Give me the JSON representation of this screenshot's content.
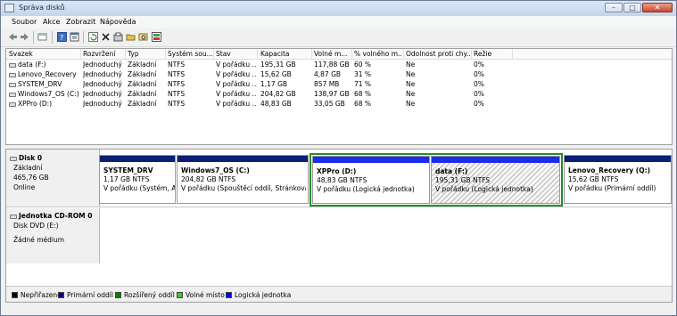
{
  "window": {
    "title": "Správa disků"
  },
  "menu": [
    "Soubor",
    "Akce",
    "Zobrazit",
    "Nápověda"
  ],
  "table": {
    "columns": [
      "Svazek",
      "Rozvržení",
      "Typ",
      "Systém sou...",
      "Stav",
      "Kapacita",
      "Volné m...",
      "% volného m...",
      "Odolnost proti chy...",
      "Režie"
    ],
    "rows": [
      [
        "data (F:)",
        "Jednoduchý",
        "Základní",
        "NTFS",
        "V pořádku ...",
        "195,31 GB",
        "117,88 GB",
        "60 %",
        "Ne",
        "0%"
      ],
      [
        "Lenovo_Recovery ...",
        "Jednoduchý",
        "Základní",
        "NTFS",
        "V pořádku ...",
        "15,62 GB",
        "4,87 GB",
        "31 %",
        "Ne",
        "0%"
      ],
      [
        "SYSTEM_DRV",
        "Jednoduchý",
        "Základní",
        "NTFS",
        "V pořádku ...",
        "1,17 GB",
        "857 MB",
        "71 %",
        "Ne",
        "0%"
      ],
      [
        "Windows7_OS (C:)",
        "Jednoduchý",
        "Základní",
        "NTFS",
        "V pořádku ...",
        "204,82 GB",
        "138,97 GB",
        "68 %",
        "Ne",
        "0%"
      ],
      [
        "XPPro (D:)",
        "Jednoduchý",
        "Základní",
        "NTFS",
        "V pořádku ...",
        "48,83 GB",
        "33,05 GB",
        "68 %",
        "Ne",
        "0%"
      ]
    ]
  },
  "disk0": {
    "name": "Disk 0",
    "type": "Základní",
    "size": "465,76 GB",
    "status": "Online",
    "partitions": [
      {
        "name": "SYSTEM_DRV",
        "size": "1,17 GB NTFS",
        "status": "V pořádku (Systém, Ak"
      },
      {
        "name": "Windows7_OS  (C:)",
        "size": "204,82 GB NTFS",
        "status": "V pořádku (Spouštěcí oddíl, Stránkovací so"
      },
      {
        "name": "XPPro  (D:)",
        "size": "48,83 GB NTFS",
        "status": "V pořádku (Logická jednotka)"
      },
      {
        "name": "data  (F:)",
        "size": "195,31 GB NTFS",
        "status": "V pořádku (Logická jednotka)"
      },
      {
        "name": "Lenovo_Recovery  (Q:)",
        "size": "15,62 GB NTFS",
        "status": "V pořádku (Primární oddíl)"
      }
    ]
  },
  "cdrom0": {
    "name": "Jednotka CD-ROM 0",
    "type": "Disk DVD (E:)",
    "status": "Žádné médium"
  },
  "legend": [
    {
      "label": "Nepřiřazeno",
      "color": "#000000"
    },
    {
      "label": "Primární oddíl",
      "color": "#000080"
    },
    {
      "label": "Rozšířený oddíl",
      "color": "#008000"
    },
    {
      "label": "Volné místo",
      "color": "#33cc33"
    },
    {
      "label": "Logická jednotka",
      "color": "#0000ff"
    }
  ]
}
